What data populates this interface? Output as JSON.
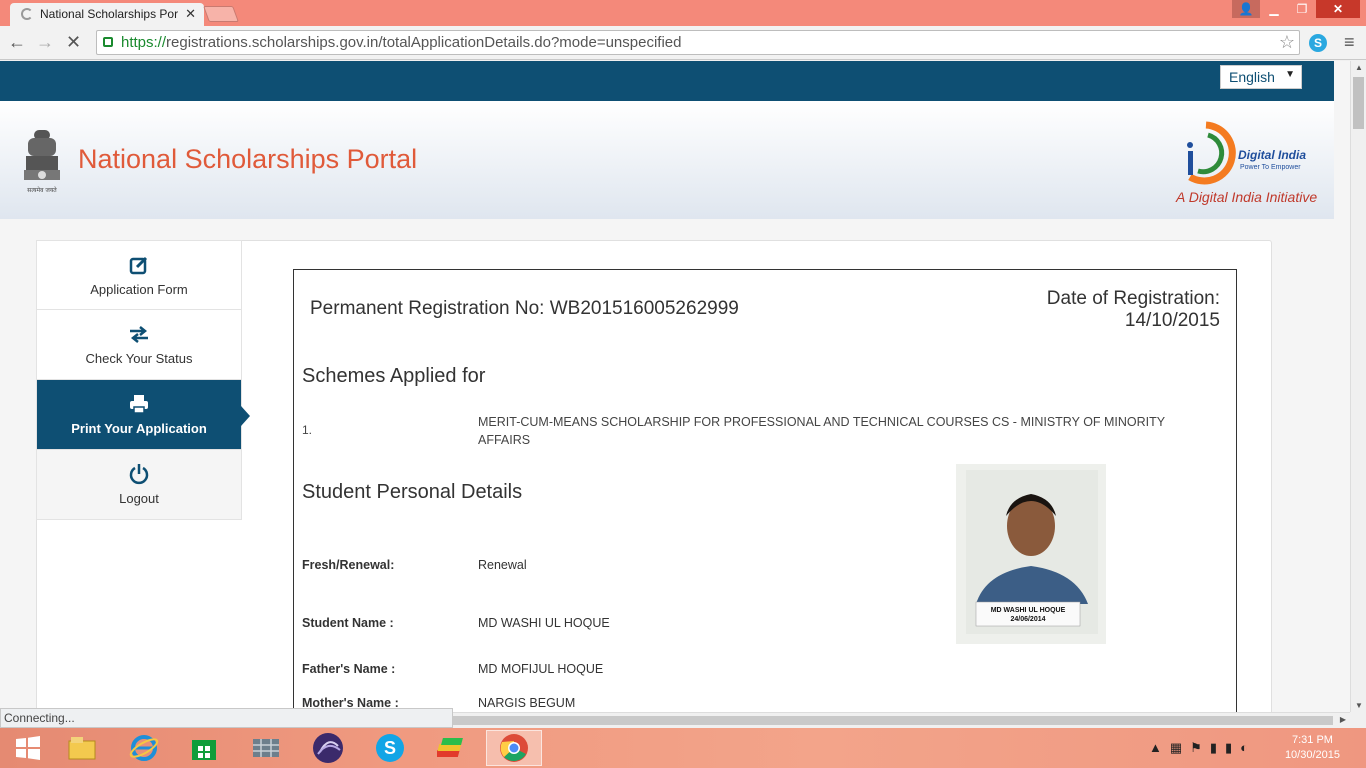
{
  "browser": {
    "tab_title": "National Scholarships Por",
    "url_scheme": "https://",
    "url_rest": "registrations.scholarships.gov.in/totalApplicationDetails.do?mode=unspecified",
    "status_text": "Connecting..."
  },
  "site": {
    "language": "English",
    "title": "National Scholarships Portal",
    "digital_india_name": "Digital India",
    "digital_india_tagline": "Power To Empower",
    "digital_india_initiative": "A Digital India Initiative",
    "emblem_caption": "सत्यमेव जयते"
  },
  "sidebar": {
    "items": [
      {
        "label": "Application Form",
        "icon": "edit-icon"
      },
      {
        "label": "Check Your Status",
        "icon": "exchange-icon"
      },
      {
        "label": "Print Your Application",
        "icon": "printer-icon"
      },
      {
        "label": "Logout",
        "icon": "power-icon"
      }
    ]
  },
  "application": {
    "reg_no": "Permanent Registration No: WB201516005262999",
    "reg_date_label": "Date of Registration:",
    "reg_date": "14/10/2015",
    "schemes_title": "Schemes Applied for",
    "scheme_number": "1.",
    "scheme_name": "MERIT-CUM-MEANS SCHOLARSHIP FOR PROFESSIONAL AND TECHNICAL COURSES CS - MINISTRY OF MINORITY AFFAIRS",
    "personal_title": "Student Personal Details",
    "fields": [
      {
        "label": "Fresh/Renewal:",
        "value": "Renewal"
      },
      {
        "label": "Student Name :",
        "value": "MD WASHI UL HOQUE"
      },
      {
        "label": "Father's Name :",
        "value": "MD MOFIJUL HOQUE"
      },
      {
        "label": "Mother's Name :",
        "value": "NARGIS BEGUM"
      }
    ],
    "photo_caption_name": "MD WASHI UL HOQUE",
    "photo_caption_date": "24/06/2014"
  },
  "taskbar": {
    "time": "7:31 PM",
    "date": "10/30/2015"
  }
}
